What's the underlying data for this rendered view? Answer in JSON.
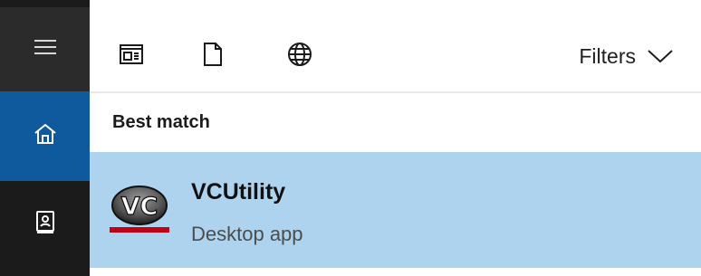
{
  "sidebar": {
    "items": [
      {
        "name": "menu",
        "icon": "hamburger-menu-icon"
      },
      {
        "name": "home",
        "icon": "home-icon",
        "active": true
      },
      {
        "name": "notebook",
        "icon": "notebook-icon"
      }
    ],
    "colors": {
      "background": "#1b1b1b",
      "menu_background": "#2b2b2b",
      "active_background": "#0f5a9c"
    }
  },
  "toolbar": {
    "icons": [
      "apps-icon",
      "documents-icon",
      "web-icon"
    ],
    "filters_label": "Filters",
    "filters_icon": "chevron-down-icon"
  },
  "results": {
    "section_title": "Best match",
    "items": [
      {
        "title": "VCUtility",
        "subtitle": "Desktop app",
        "icon": "vcutility-app-icon",
        "selected": true
      }
    ],
    "colors": {
      "selected_background": "#aed3ef"
    }
  }
}
